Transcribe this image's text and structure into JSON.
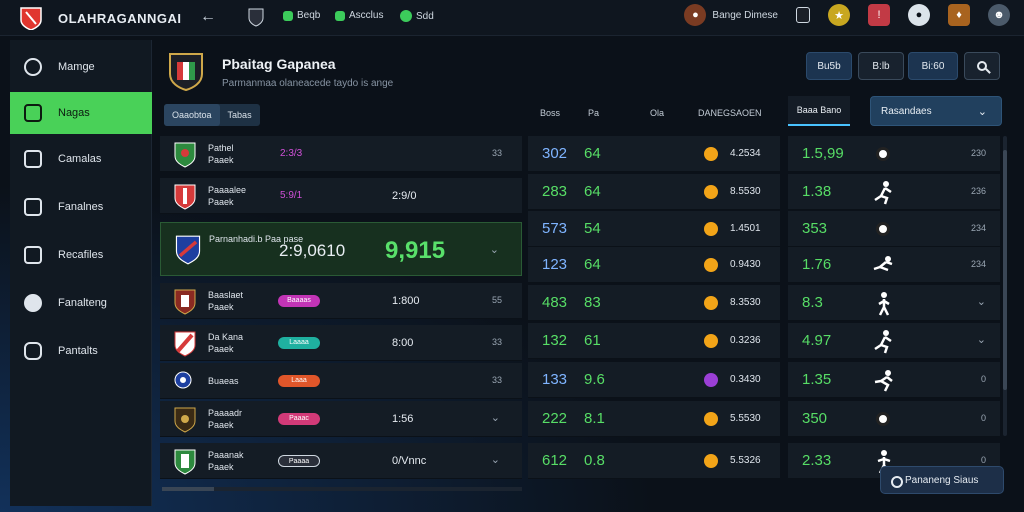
{
  "app": {
    "brand": "OLAHRAGANNGAI"
  },
  "topnav": {
    "items": [
      {
        "label": "Beqb",
        "icon": "shield-icon"
      },
      {
        "label": "Ascclus",
        "icon": "flag-icon"
      },
      {
        "label": "Sdd",
        "icon": "record-icon"
      }
    ],
    "account_label": "Bange Dimese"
  },
  "sidebar": {
    "items": [
      {
        "label": "Mamge",
        "icon": "home-icon"
      },
      {
        "label": "Nagas",
        "icon": "grid-icon"
      },
      {
        "label": "Camalas",
        "icon": "clipboard-icon"
      },
      {
        "label": "Fanalnes",
        "icon": "mail-icon"
      },
      {
        "label": "Recafiles",
        "icon": "table-icon"
      },
      {
        "label": "Fanalteng",
        "icon": "ball-icon"
      },
      {
        "label": "Pantalts",
        "icon": "puzzle-icon"
      }
    ],
    "active_index": 1
  },
  "header": {
    "title": "Pbaitag Gapanea",
    "subtitle": "Parmanmaa olaneacede taydo is ange",
    "buttons": [
      "Bu5b",
      "B:lb",
      "Bi:60"
    ],
    "filter_tabs": [
      "Oaaobtoa",
      "Tabas"
    ],
    "columns": [
      "Boss",
      "Pa",
      "Ola",
      "DANEGSAOEN"
    ],
    "best_tab": "Baaa Bano",
    "recommend_label": "Rasandaes"
  },
  "left_rows": [
    {
      "team": "Pathel\nPaaek",
      "odd": "2:3/3",
      "value": "",
      "right": "33"
    },
    {
      "team": "Paaaalee\nPaaek",
      "odd": "5:9/1",
      "value": "2:9/0",
      "right": ""
    },
    {
      "team": "Parnanhadi.b\nPaa pase",
      "big_a": "2:9,0610",
      "big_b": "9,915",
      "right": ""
    },
    {
      "team": "Baaslaet\nPaaek",
      "pill": "Baaaas",
      "value": "1:800",
      "right": "55"
    },
    {
      "team": "Da Kana\nPaaek",
      "pill": "Laaaa",
      "value": "8:00",
      "right": "33"
    },
    {
      "team": "Buaeas",
      "pill": "Laaa",
      "value": "",
      "right": "33"
    },
    {
      "team": "Paaaadr\nPaaek",
      "pill": "Paaac",
      "value": "1:56",
      "right": ""
    },
    {
      "team": "Paaanak\nPaaek",
      "pill": "Paaaa",
      "value": "0/Vnnc",
      "right": ""
    }
  ],
  "mid_rows": [
    {
      "v1": "302",
      "v2": "64",
      "amt": "4.2534"
    },
    {
      "v1": "283",
      "v2": "64",
      "amt": "8.5530"
    },
    {
      "v1": "573",
      "v2": "54",
      "amt": "1.4501"
    },
    {
      "v1": "123",
      "v2": "64",
      "amt": "0.9430"
    },
    {
      "v1": "483",
      "v2": "83",
      "amt": "8.3530"
    },
    {
      "v1": "132",
      "v2": "61",
      "amt": "0.3236"
    },
    {
      "v1": "133",
      "v2": "9.6",
      "amt": "0.3430"
    },
    {
      "v1": "222",
      "v2": "8.1",
      "amt": "5.5530"
    },
    {
      "v1": "612",
      "v2": "0.8",
      "amt": "5.5326"
    }
  ],
  "right_rows": [
    {
      "v": "1.5,99",
      "r": "230"
    },
    {
      "v": "1.38",
      "r": "236"
    },
    {
      "v": "353",
      "r": "234"
    },
    {
      "v": "1.76",
      "r": "234"
    },
    {
      "v": "8.3",
      "r": ""
    },
    {
      "v": "4.97",
      "r": ""
    },
    {
      "v": "1.35",
      "r": "0"
    },
    {
      "v": "350",
      "r": "0"
    },
    {
      "v": "2.33",
      "r": "0"
    }
  ],
  "toast": {
    "label": "Pananeng Siaus"
  },
  "colors": {
    "accent_green": "#49d158",
    "value_green": "#57dd66",
    "odd_magenta": "#d050d8",
    "highlight_blue": "#49c3ff"
  }
}
